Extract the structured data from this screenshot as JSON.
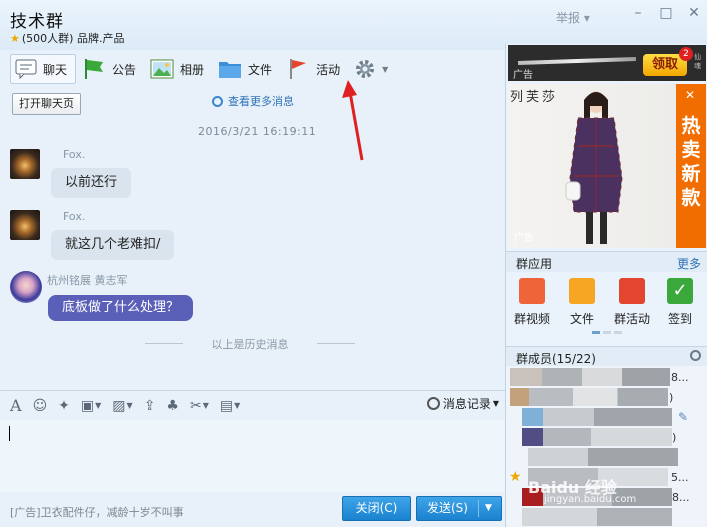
{
  "window": {
    "title": "技术群",
    "member_count": "(500人群)",
    "tags": "品牌.产品",
    "report": "举报"
  },
  "tabs": [
    {
      "label": "聊天",
      "icon": "chat-icon"
    },
    {
      "label": "公告",
      "icon": "announcement-flag-icon"
    },
    {
      "label": "相册",
      "icon": "album-icon"
    },
    {
      "label": "文件",
      "icon": "folder-icon"
    },
    {
      "label": "活动",
      "icon": "activity-flag-icon"
    }
  ],
  "chat": {
    "open_button": "打开聊天页",
    "more_messages": "查看更多消息",
    "timestamp": "2016/3/21 16:19:11",
    "messages": [
      {
        "sender": "Fox.",
        "text": "以前还行"
      },
      {
        "sender": "Fox.",
        "text": "就这几个老难扣/"
      },
      {
        "sender": "杭州铭展 黄志军",
        "text": "底板做了什么处理？"
      }
    ],
    "history_divider": "以上是历史消息"
  },
  "input_toolbar": {
    "history_button": "消息记录"
  },
  "bottom": {
    "ad_text": "[广告]卫衣配件仔，减龄十岁不叫事",
    "close_label": "关闭(C)",
    "send_label": "发送(S)"
  },
  "right_panel": {
    "banner": {
      "ad_label": "广告",
      "claim": "领取",
      "badge": "2",
      "logo": "仙魂"
    },
    "ad_image": {
      "brand": "列芙莎",
      "side_text": "热卖新款",
      "tag": "广告"
    },
    "apps_title": "群应用",
    "apps_more": "更多",
    "apps": [
      {
        "label": "群视频",
        "color": "#f0643a"
      },
      {
        "label": "文件",
        "color": "#f6a623"
      },
      {
        "label": "群活动",
        "color": "#e4452e"
      },
      {
        "label": "签到",
        "color": "#3aa83a"
      }
    ],
    "members_title": "群成员(15/22)",
    "member_fragments": [
      "8...",
      ")",
      ")",
      "5...",
      "8..."
    ],
    "watermark": "Baidu 经验",
    "watermark_url": "jingyan.baidu.com"
  },
  "colors": {
    "accent": "#1a82cf",
    "link": "#2d73b8",
    "bubble": "#d9e4ee",
    "bubble_special": "#5a5fb8",
    "arrow": "#e02020"
  }
}
